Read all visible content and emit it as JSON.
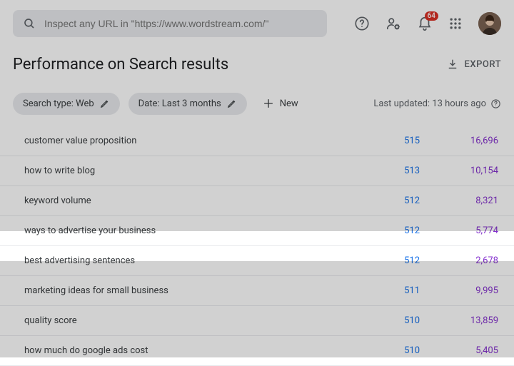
{
  "search": {
    "placeholder": "Inspect any URL in \"https://www.wordstream.com/\""
  },
  "notifications": {
    "count": "64"
  },
  "title": "Performance on Search results",
  "export_label": "EXPORT",
  "filters": {
    "search_type": "Search type: Web",
    "date": "Date: Last 3 months",
    "new_label": "New"
  },
  "last_updated": "Last updated: 13 hours ago",
  "rows": [
    {
      "query": "customer value proposition",
      "a": "515",
      "b": "16,696"
    },
    {
      "query": "how to write blog",
      "a": "513",
      "b": "10,154"
    },
    {
      "query": "keyword volume",
      "a": "512",
      "b": "8,321"
    },
    {
      "query": "ways to advertise your business",
      "a": "512",
      "b": "5,774"
    },
    {
      "query": "best advertising sentences",
      "a": "512",
      "b": "2,678"
    },
    {
      "query": "marketing ideas for small business",
      "a": "511",
      "b": "9,995"
    },
    {
      "query": "quality score",
      "a": "510",
      "b": "13,859"
    },
    {
      "query": "how much do google ads cost",
      "a": "510",
      "b": "5,405"
    }
  ],
  "highlighted_index": 4
}
